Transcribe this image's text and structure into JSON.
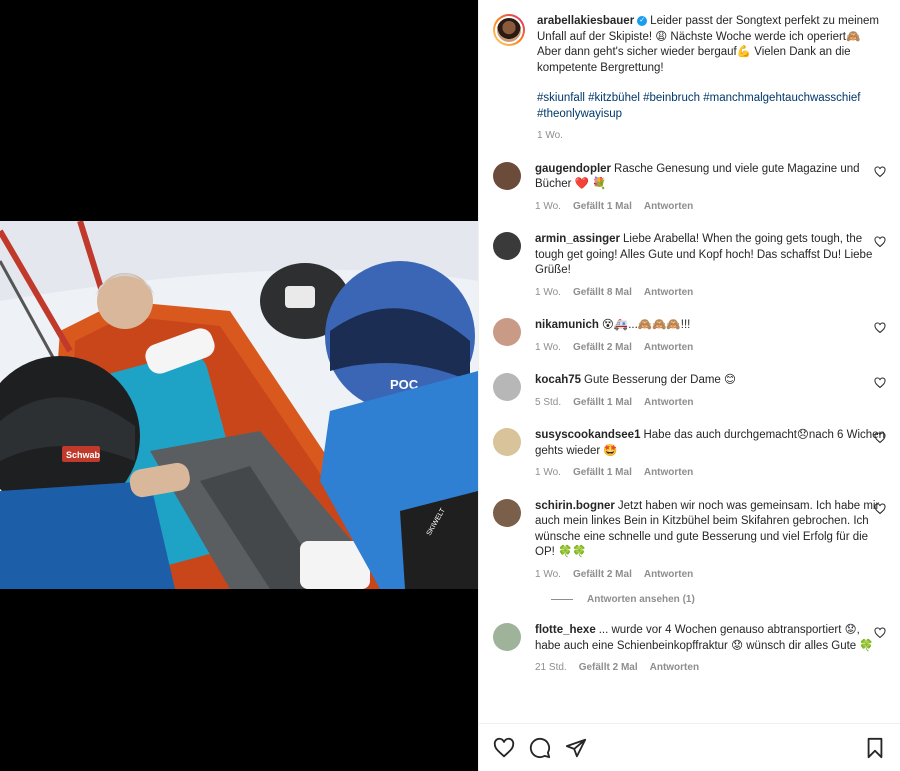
{
  "post": {
    "username": "arabellakiesbauer",
    "caption": "Leider passt der Songtext perfekt zu meinem Unfall auf der Skipiste! 😩 Nächste Woche werde ich operiert🙈 Aber dann geht's sicher wieder bergauf💪 Vielen Dank an die kompetente Bergrettung!",
    "hashtags": "#skiunfall #kitzbühel #beinbruch #manchmalgehtauchwasschief #theonlywayisup",
    "age": "1 Wo."
  },
  "comments": [
    {
      "username": "gaugendopler",
      "text": "Rasche Genesung und viele gute Magazine und Bücher ❤️ 💐",
      "age": "1 Wo.",
      "likes": "Gefällt 1 Mal",
      "reply": "Antworten",
      "avatar_color": "#6b4b3a"
    },
    {
      "username": "armin_assinger",
      "text": "Liebe Arabella! When the going gets tough, the tough get going! Alles Gute und Kopf hoch! Das schaffst Du! Liebe Grüße!",
      "age": "1 Wo.",
      "likes": "Gefällt 8 Mal",
      "reply": "Antworten",
      "avatar_color": "#3a3a3a"
    },
    {
      "username": "nikamunich",
      "text": "😵🚑...🙈🙈🙈!!!",
      "age": "1 Wo.",
      "likes": "Gefällt 2 Mal",
      "reply": "Antworten",
      "avatar_color": "#c99a86"
    },
    {
      "username": "kocah75",
      "text": "Gute Besserung der Dame 😊",
      "age": "5 Std.",
      "likes": "Gefällt 1 Mal",
      "reply": "Antworten",
      "avatar_color": "#b7b7b7"
    },
    {
      "username": "susyscookandsee1",
      "text": "Habe das auch durchgemacht😞nach 6 Wichen gehts wieder 🤩",
      "age": "1 Wo.",
      "likes": "Gefällt 1 Mal",
      "reply": "Antworten",
      "avatar_color": "#d8c39a"
    },
    {
      "username": "schirin.bogner",
      "text": "Jetzt haben wir noch was gemeinsam. Ich habe mir auch mein linkes Bein in Kitzbühel beim Skifahren gebrochen. Ich wünsche eine schnelle und gute Besserung und viel Erfolg für die OP! 🍀🍀",
      "age": "1 Wo.",
      "likes": "Gefällt 2 Mal",
      "reply": "Antworten",
      "avatar_color": "#7a5f4a"
    },
    {
      "username": "flotte_hexe",
      "text": "... wurde vor 4 Wochen genauso abtransportiert 😟, habe auch eine Schienbeinkopffraktur 😟 wünsch dir alles Gute 🍀",
      "age": "21 Std.",
      "likes": "Gefällt 2 Mal",
      "reply": "Antworten",
      "avatar_color": "#9fb39a"
    }
  ],
  "view_replies": "Antworten ansehen (1)",
  "photo": {
    "helmet_brand": "POC",
    "helmet_sticker": "Schwab",
    "bag_text": "SKIWELT"
  },
  "colors": {
    "link": "#00376b",
    "meta": "#8e8e8e",
    "verified": "#1a9cf0"
  },
  "icons": [
    "heart-icon",
    "comment-icon",
    "share-icon",
    "bookmark-icon"
  ]
}
